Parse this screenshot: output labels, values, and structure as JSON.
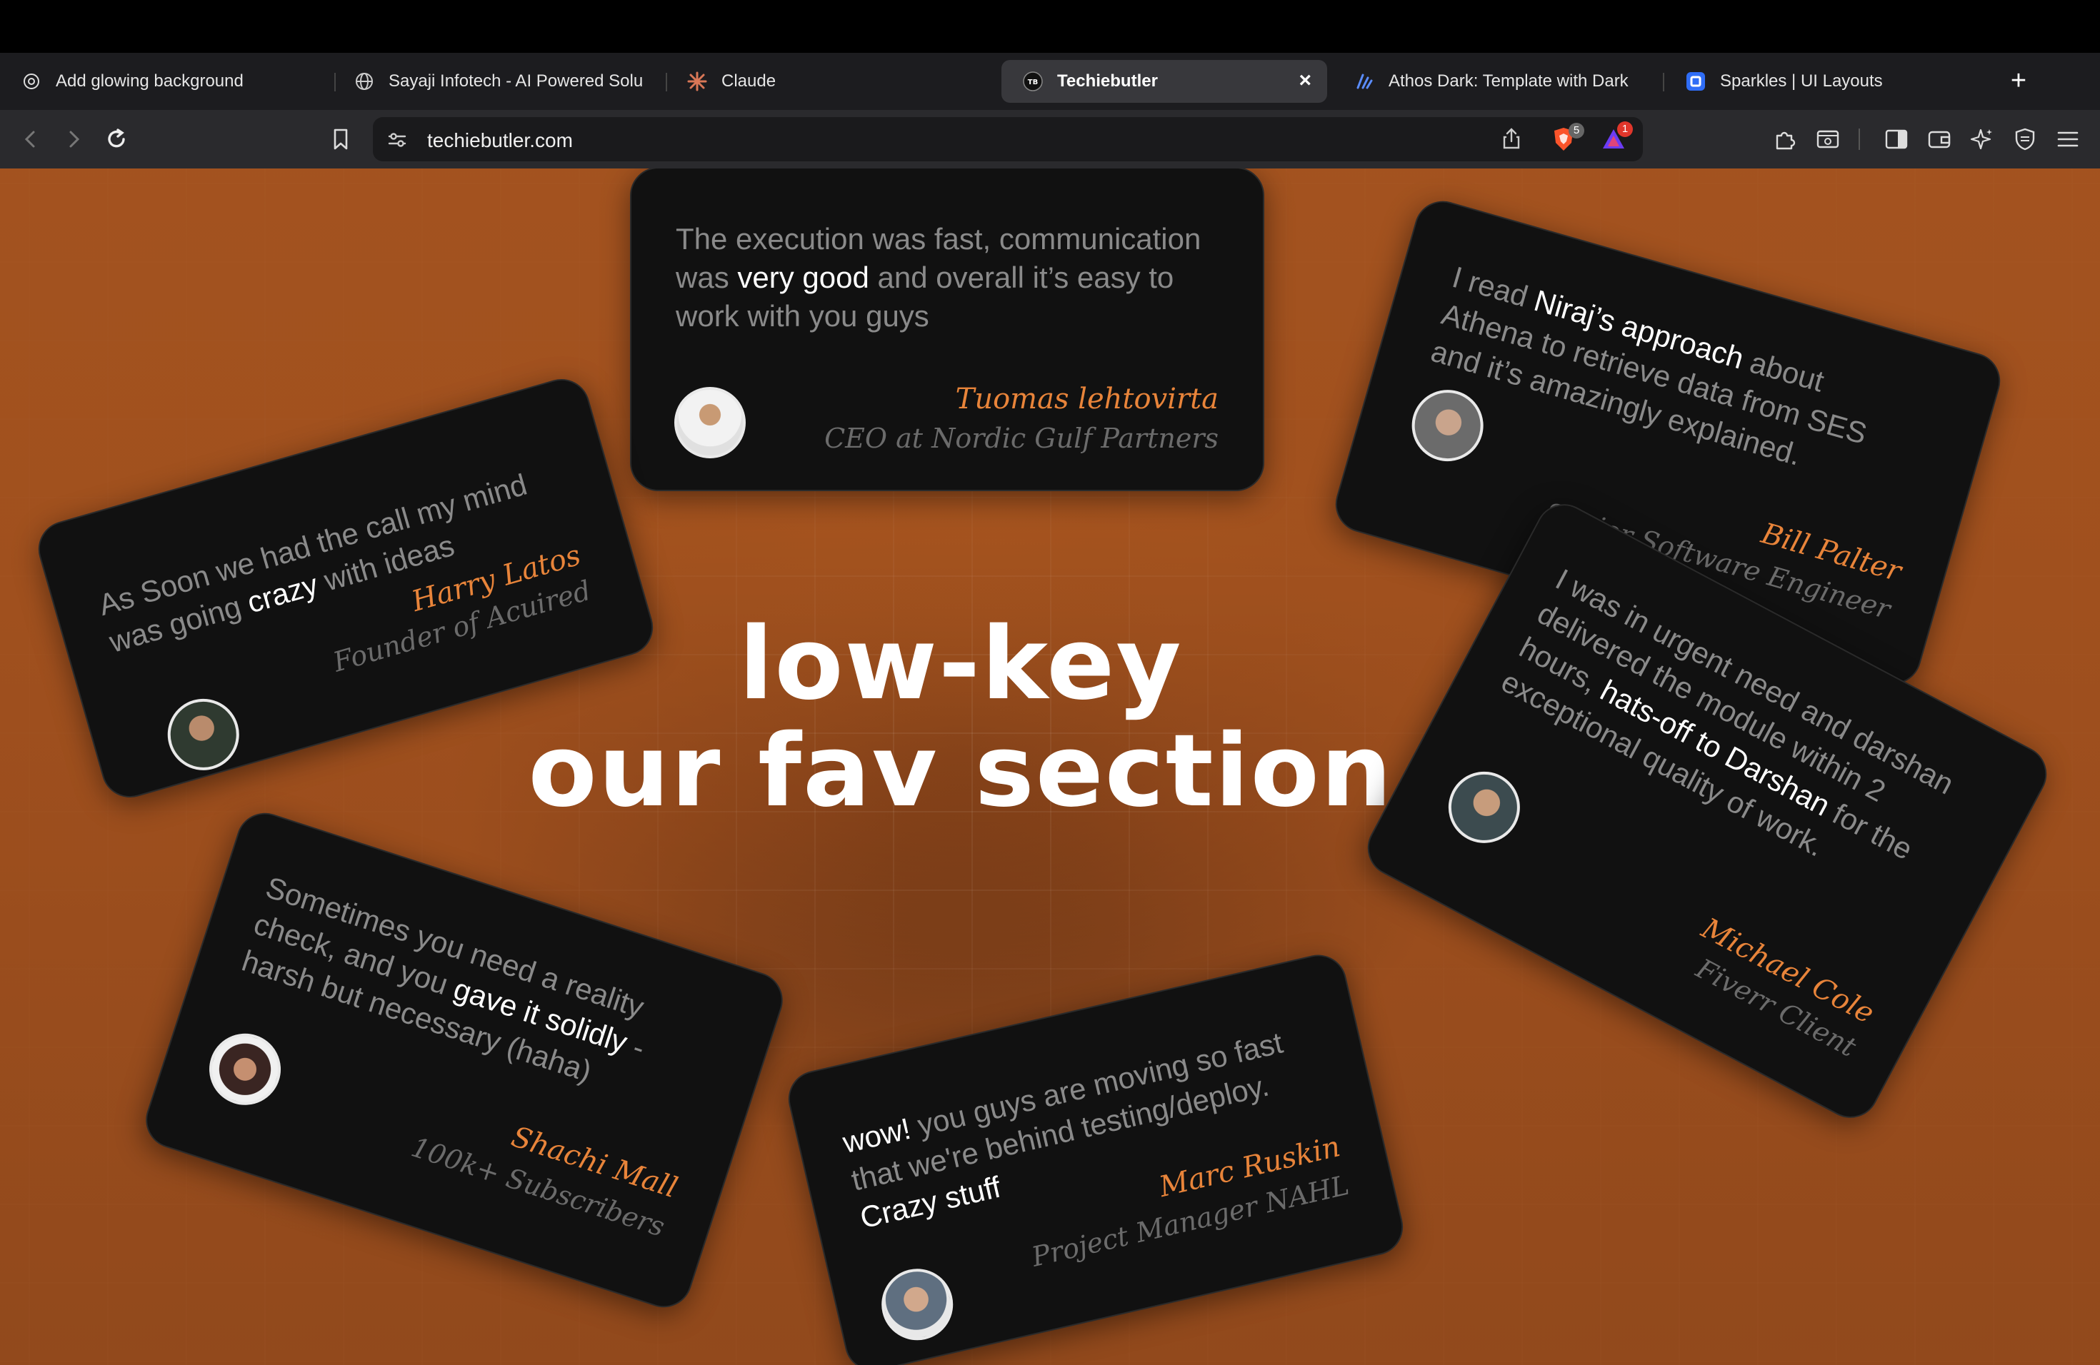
{
  "browser": {
    "tabs": [
      {
        "title": "Add glowing background",
        "icon": "openai-icon"
      },
      {
        "title": "Sayaji Infotech - AI Powered Solu",
        "icon": "globe-icon"
      },
      {
        "title": "Claude",
        "icon": "claude-icon"
      },
      {
        "title": "Techiebutler",
        "icon": "techiebutler-icon",
        "active": true
      },
      {
        "title": "Athos Dark: Template with Dark",
        "icon": "athos-icon"
      },
      {
        "title": "Sparkles | UI Layouts",
        "icon": "ui-layouts-icon"
      }
    ],
    "url": "techiebutler.com",
    "brave_badge": "5",
    "rewards_badge": "1"
  },
  "page": {
    "headline_line1": "low-key",
    "headline_line2": "our fav section"
  },
  "testimonials": [
    {
      "q_pre": "The execution was fast, communication was ",
      "q_hl": "very good",
      "q_post": " and overall it’s easy to work with you guys",
      "name": "Tuomas lehtovirta",
      "role": "CEO at Nordic Gulf Partners"
    },
    {
      "q_pre": "As Soon we had the call my mind was going ",
      "q_hl": "crazy",
      "q_post": " with ideas",
      "name": "Harry Latos",
      "role": "Founder of Acuired"
    },
    {
      "q_pre": "I read ",
      "q_hl": "Niraj’s approach",
      "q_post": " about Athena to retrieve data from SES and it’s amazingly explained.",
      "name": "Bill Palter",
      "role": "Senior Software Engineer"
    },
    {
      "q_pre": "I was in urgent need and darshan delivered the module within 2 hours, ",
      "q_hl": "hats-off to Darshan",
      "q_post": " for the exceptional quality of work.",
      "name": "Michael Cole",
      "role": "Fiverr Client"
    },
    {
      "q_pre": "Sometimes you need a reality check, and you ",
      "q_hl": "gave it solidly",
      "q_post": " - harsh but necessary (haha)",
      "name": "Shachi Mall",
      "role": "100k+ Subscribers"
    },
    {
      "q_pre": "",
      "q_hl": "wow!",
      "q_post": " you guys are moving so fast that we're behind testing/deploy. ",
      "q_hl2": "Crazy stuff",
      "name": "Marc Ruskin",
      "role": "Project Manager NAHL"
    }
  ],
  "colors": {
    "accent": "#e8843a",
    "card": "#111111",
    "muted_text": "#8a8a8a"
  }
}
